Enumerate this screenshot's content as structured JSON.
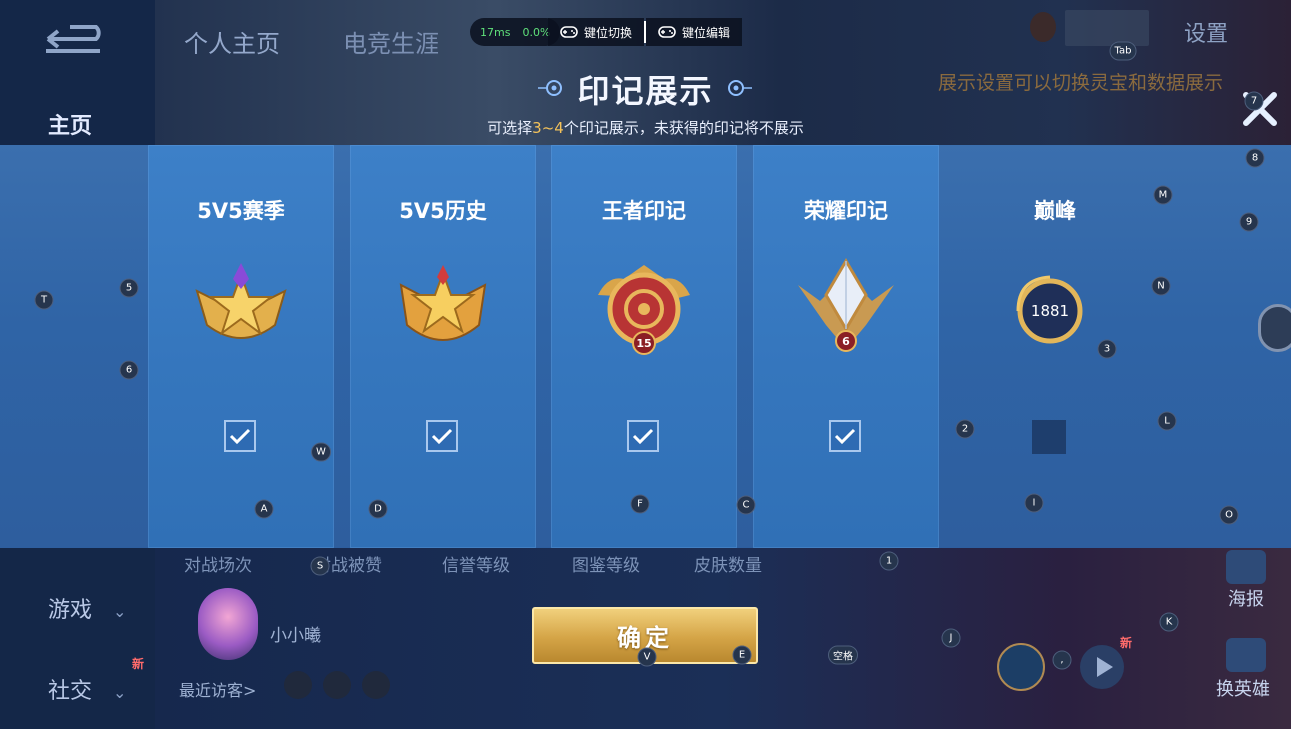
{
  "nav": {
    "home": "主页",
    "game": "游戏",
    "social": "社交",
    "social_new": "新"
  },
  "tabs": {
    "profile": "个人主页",
    "career": "电竞生涯"
  },
  "header": {
    "settings": "设置",
    "hint": "展示设置可以切换灵宝和数据展示"
  },
  "overlay": {
    "ping": "17ms",
    "loss": "0.0%",
    "key_switch": "键位切换",
    "key_edit": "键位编辑"
  },
  "dialog": {
    "title": "印记展示",
    "subtitle_pre": "可选择",
    "subtitle_range": "3~4",
    "subtitle_post": "个印记展示，未获得的印记将不展示",
    "confirm": "确定"
  },
  "cards": [
    {
      "title": "5V5赛季",
      "checked": true,
      "badge": "season-star-badge-icon"
    },
    {
      "title": "5V5历史",
      "checked": true,
      "badge": "history-star-badge-icon"
    },
    {
      "title": "王者印记",
      "checked": true,
      "badge": "king-emblem-icon",
      "level": "15"
    },
    {
      "title": "荣耀印记",
      "checked": true,
      "badge": "glory-emblem-icon",
      "level": "6"
    },
    {
      "title": "巅峰",
      "checked": false,
      "badge": "peak-rating-icon",
      "rating": "1881"
    }
  ],
  "stats": {
    "matches": "对战场次",
    "likes": "对战被赞",
    "credit": "信誉等级",
    "codex": "图鉴等级",
    "skins": "皮肤数量"
  },
  "profile": {
    "username": "小小曦",
    "recent_visitors": "最近访客>"
  },
  "right_actions": {
    "poster": "海报",
    "switch_hero": "换英雄",
    "new": "新"
  },
  "keys": {
    "tab": "Tab",
    "k7": "7",
    "k8": "8",
    "k9": "9",
    "m": "M",
    "n": "N",
    "t": "T",
    "k5": "5",
    "k6": "6",
    "k3": "3",
    "k2": "2",
    "l": "L",
    "w": "W",
    "i": "I",
    "a": "A",
    "d": "D",
    "f": "F",
    "c": "C",
    "o": "O",
    "s": "S",
    "k1": "1",
    "j": "J",
    "k": "K",
    "v": "V",
    "e": "E",
    "space": "空格",
    "comma": ","
  },
  "colors": {
    "accent_gold": "#f3c25a",
    "panel_blue": "#3576bd",
    "ping_green": "#5fe07a"
  }
}
